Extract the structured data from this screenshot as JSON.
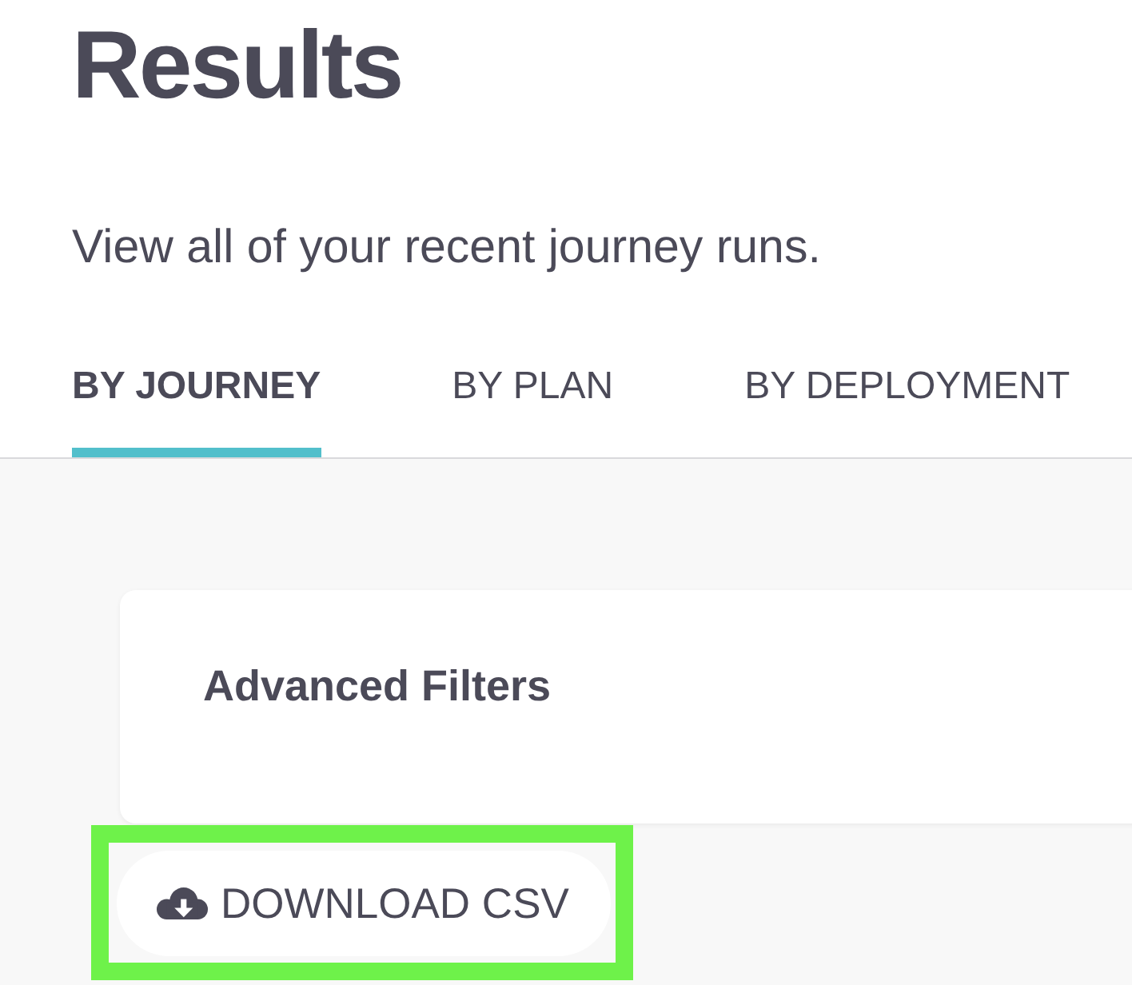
{
  "page": {
    "title": "Results",
    "subtitle": "View all of your recent journey runs."
  },
  "tabs": [
    {
      "label": "BY JOURNEY",
      "selected": true
    },
    {
      "label": "BY PLAN",
      "selected": false
    },
    {
      "label": "BY DEPLOYMENT",
      "selected": false
    }
  ],
  "filters_panel": {
    "title": "Advanced Filters"
  },
  "download_button": {
    "label": "DOWNLOAD CSV",
    "highlighted": true
  }
}
